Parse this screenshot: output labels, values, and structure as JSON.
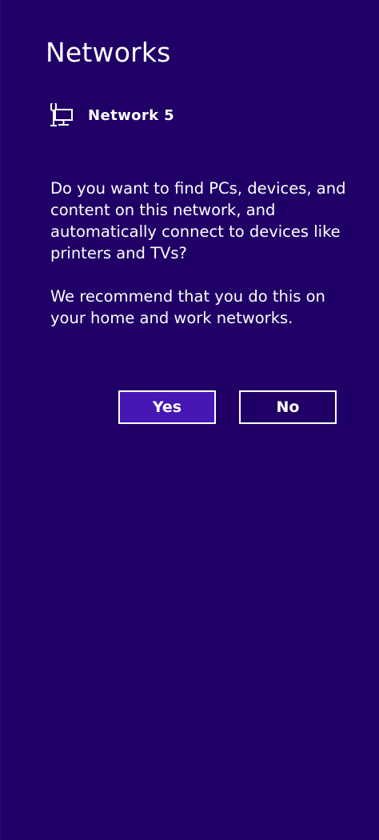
{
  "pane": {
    "title": "Networks",
    "network_name": "Network  5",
    "network_icon": "wired-network-pc-icon"
  },
  "prompt": {
    "question": "Do you want to find PCs, devices, and content on this network, and automatically connect to devices like printers and TVs?",
    "recommendation": "We recommend that you do this on your home and work networks."
  },
  "buttons": {
    "yes_label": "Yes",
    "no_label": "No"
  },
  "colors": {
    "background": "#200066",
    "accent_button": "#4617b4",
    "text": "#ffffff"
  }
}
